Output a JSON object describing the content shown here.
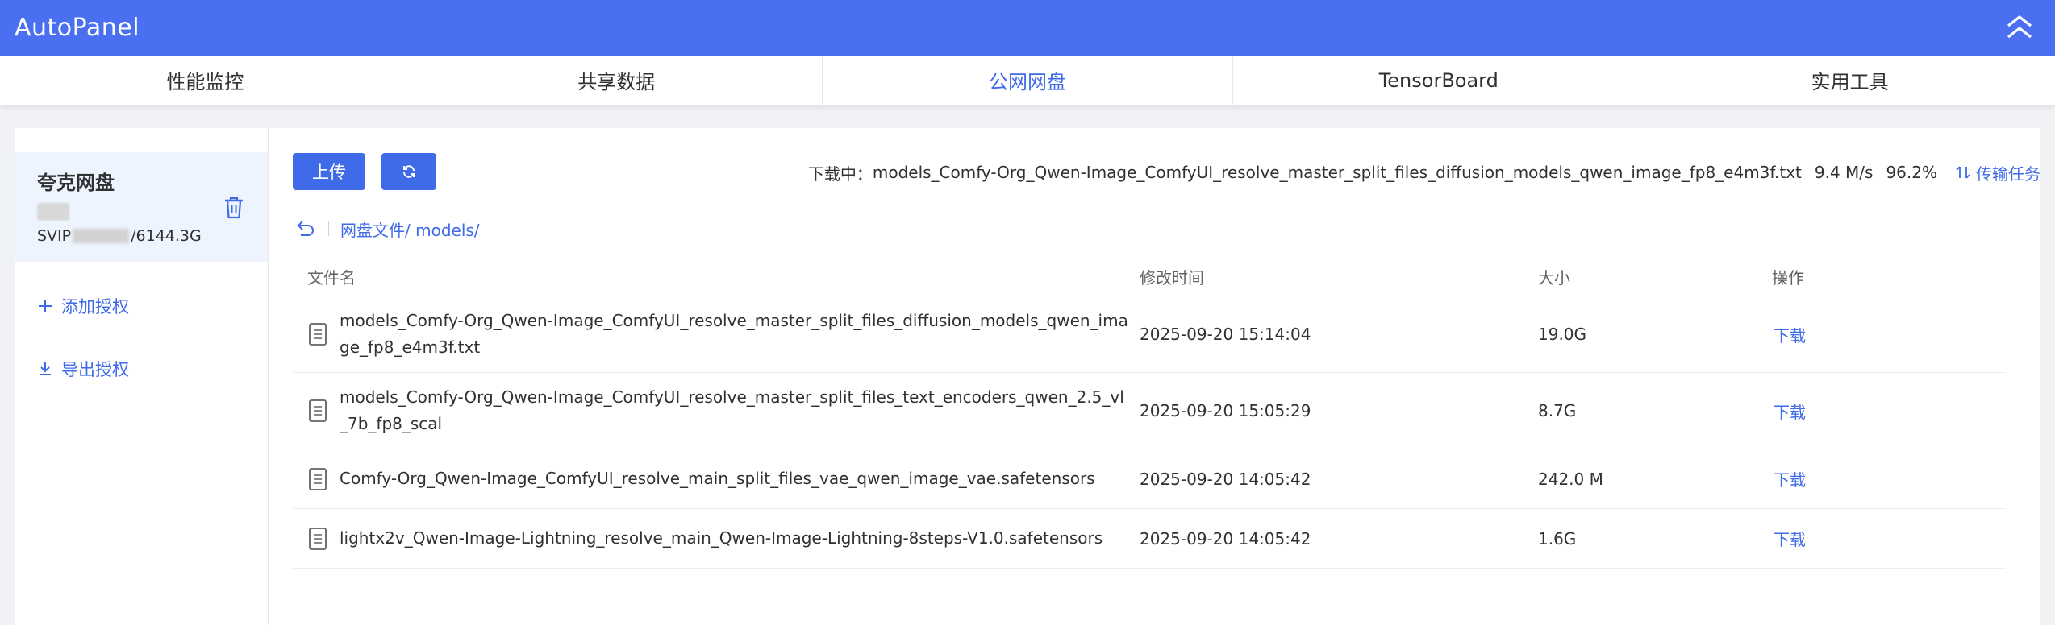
{
  "app": {
    "title": "AutoPanel",
    "accent_color": "#4a6ff0"
  },
  "tabs": [
    {
      "label": "性能监控",
      "active": false
    },
    {
      "label": "共享数据",
      "active": false
    },
    {
      "label": "公网网盘",
      "active": true
    },
    {
      "label": "TensorBoard",
      "active": false
    },
    {
      "label": "实用工具",
      "active": false
    }
  ],
  "sidebar": {
    "account": {
      "name": "夸克网盘",
      "quota_prefix": "SVIP",
      "quota_suffix": "/6144.3G"
    },
    "add_auth_label": "添加授权",
    "export_auth_label": "导出授权"
  },
  "toolbar": {
    "upload_label": "上传",
    "refresh_icon": "refresh-icon"
  },
  "download_status": {
    "label": "下载中：",
    "file": "models_Comfy-Org_Qwen-Image_ComfyUI_resolve_master_split_files_diffusion_models_qwen_image_fp8_e4m3f.txt",
    "speed": "9.4 M/s",
    "percent": "96.2%",
    "tasks_label": "传输任务"
  },
  "breadcrumb": {
    "path": "网盘文件/ models/"
  },
  "table": {
    "headers": {
      "name": "文件名",
      "time": "修改时间",
      "size": "大小",
      "op": "操作"
    },
    "rows": [
      {
        "name": "models_Comfy-Org_Qwen-Image_ComfyUI_resolve_master_split_files_diffusion_models_qwen_image_fp8_e4m3f.txt",
        "time": "2025-09-20 15:14:04",
        "size": "19.0G",
        "op": "下载"
      },
      {
        "name": "models_Comfy-Org_Qwen-Image_ComfyUI_resolve_master_split_files_text_encoders_qwen_2.5_vl_7b_fp8_scal",
        "time": "2025-09-20 15:05:29",
        "size": "8.7G",
        "op": "下载"
      },
      {
        "name": "Comfy-Org_Qwen-Image_ComfyUI_resolve_main_split_files_vae_qwen_image_vae.safetensors",
        "time": "2025-09-20 14:05:42",
        "size": "242.0 M",
        "op": "下载"
      },
      {
        "name": "lightx2v_Qwen-Image-Lightning_resolve_main_Qwen-Image-Lightning-8steps-V1.0.safetensors",
        "time": "2025-09-20 14:05:42",
        "size": "1.6G",
        "op": "下载"
      }
    ]
  }
}
